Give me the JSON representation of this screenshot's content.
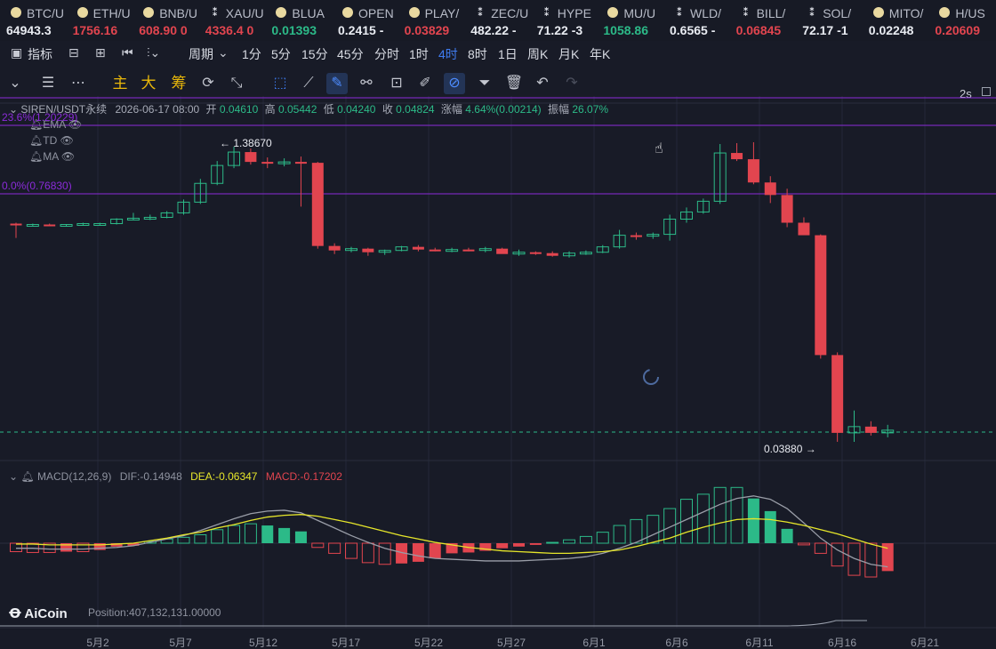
{
  "ticker": [
    {
      "symbol": "BTC/U",
      "price": "64943.3",
      "color": "#e9ecf2",
      "icon": "coin"
    },
    {
      "symbol": "ETH/U",
      "price": "1756.16",
      "color": "#e2454f",
      "icon": "coin"
    },
    {
      "symbol": "BNB/U",
      "price": "608.90",
      "suffix": "0",
      "color": "#e2454f",
      "icon": "coin"
    },
    {
      "symbol": "XAU/U",
      "price": "4336.4",
      "suffix": "0",
      "color": "#e2454f",
      "icon": "x"
    },
    {
      "symbol": "BLUA",
      "price": "0.01393",
      "color": "#2cba88",
      "icon": "coin"
    },
    {
      "symbol": "OPEN",
      "price": "0.2415",
      "suffix": "-",
      "color": "#e9ecf2",
      "icon": "coin"
    },
    {
      "symbol": "PLAY/",
      "price": "0.03829",
      "color": "#e2454f",
      "icon": "coin"
    },
    {
      "symbol": "ZEC/U",
      "price": "482.22",
      "suffix": "-",
      "color": "#e9ecf2",
      "icon": "x"
    },
    {
      "symbol": "HYPE",
      "price": "71.22",
      "suffix": "-3",
      "color": "#e9ecf2",
      "icon": "x"
    },
    {
      "symbol": "MU/U",
      "price": "1058.86",
      "color": "#2cba88",
      "icon": "coin"
    },
    {
      "symbol": "WLD/",
      "price": "0.6565",
      "suffix": "-",
      "color": "#e9ecf2",
      "icon": "x"
    },
    {
      "symbol": "BILL/",
      "price": "0.06845",
      "color": "#e2454f",
      "icon": "x"
    },
    {
      "symbol": "SOL/",
      "price": "72.17",
      "suffix": "-1",
      "color": "#e9ecf2",
      "icon": "x"
    },
    {
      "symbol": "MITO/",
      "price": "0.02248",
      "color": "#e9ecf2",
      "icon": "coin"
    },
    {
      "symbol": "H/US",
      "price": "0.20609",
      "color": "#e2454f",
      "icon": "coin"
    }
  ],
  "intervals": {
    "indicator_label": "指标",
    "period_label": "周期",
    "items": [
      "1分",
      "5分",
      "15分",
      "45分",
      "分时",
      "1时",
      "4时",
      "8时",
      "1日",
      "周K",
      "月K",
      "年K"
    ],
    "active": "4时",
    "refresh": "2s"
  },
  "drawing_tools": {
    "main_label": "主",
    "big_label": "大",
    "chip_label": "筹"
  },
  "chart_info": {
    "symbol": "SIREN/USDT永续",
    "time": "2026-06-17 08:00",
    "open_label": "开",
    "open": "0.04610",
    "high_label": "高",
    "high": "0.05442",
    "low_label": "低",
    "low": "0.04240",
    "close_label": "收",
    "close": "0.04824",
    "change_label": "涨幅",
    "change": "4.64%(0.00214)",
    "amp_label": "振幅",
    "amp": "26.07%",
    "indicators": [
      "EMA",
      "TD",
      "MA"
    ],
    "fib_top": "23.6%(1.20229)",
    "fib_mid": "0.0%(0.76830)",
    "high_marker": "1.38670",
    "low_marker": "0.03880"
  },
  "macd": {
    "title": "MACD(12,26,9)",
    "dif_label": "DIF:",
    "dif": "-0.14948",
    "dea_label": "DEA:",
    "dea": "-0.06347",
    "macd_label": "MACD:",
    "macd": "-0.17202"
  },
  "position_text": "Position:407,132,131.00000",
  "watermark": "AiCoin",
  "colors": {
    "up": "#2cba88",
    "down": "#e2454f",
    "dea": "#e6e62a",
    "dif": "#9a9ea8",
    "fib": "#8b2bd9",
    "accent": "#3f7cf0"
  },
  "chart_data": {
    "type": "candlestick",
    "interval": "4时",
    "x_ticks": [
      "5月2",
      "5月7",
      "5月12",
      "5月17",
      "5月22",
      "5月27",
      "6月1",
      "6月6",
      "6月11",
      "6月16",
      "6月21"
    ],
    "candles": [
      [
        0.52,
        0.53,
        0.36,
        0.51
      ],
      [
        0.51,
        0.52,
        0.49,
        0.51
      ],
      [
        0.51,
        0.52,
        0.5,
        0.5
      ],
      [
        0.5,
        0.51,
        0.49,
        0.51
      ],
      [
        0.51,
        0.53,
        0.5,
        0.52
      ],
      [
        0.52,
        0.53,
        0.5,
        0.52
      ],
      [
        0.52,
        0.58,
        0.51,
        0.57
      ],
      [
        0.57,
        0.64,
        0.56,
        0.58
      ],
      [
        0.58,
        0.62,
        0.56,
        0.59
      ],
      [
        0.59,
        0.66,
        0.58,
        0.64
      ],
      [
        0.64,
        0.79,
        0.62,
        0.76
      ],
      [
        0.76,
        1.02,
        0.74,
        0.97
      ],
      [
        0.97,
        1.22,
        0.95,
        1.17
      ],
      [
        1.17,
        1.38,
        1.14,
        1.32
      ],
      [
        1.32,
        1.36,
        1.18,
        1.21
      ],
      [
        1.21,
        1.26,
        1.14,
        1.19
      ],
      [
        1.19,
        1.25,
        1.16,
        1.21
      ],
      [
        1.21,
        1.27,
        0.71,
        1.2
      ],
      [
        1.2,
        1.21,
        0.24,
        0.27
      ],
      [
        0.27,
        0.3,
        0.18,
        0.22
      ],
      [
        0.22,
        0.26,
        0.2,
        0.24
      ],
      [
        0.24,
        0.25,
        0.16,
        0.2
      ],
      [
        0.2,
        0.23,
        0.17,
        0.22
      ],
      [
        0.22,
        0.27,
        0.21,
        0.26
      ],
      [
        0.26,
        0.28,
        0.21,
        0.23
      ],
      [
        0.23,
        0.25,
        0.21,
        0.22
      ],
      [
        0.22,
        0.25,
        0.2,
        0.23
      ],
      [
        0.23,
        0.25,
        0.21,
        0.22
      ],
      [
        0.22,
        0.26,
        0.2,
        0.24
      ],
      [
        0.24,
        0.25,
        0.19,
        0.18
      ],
      [
        0.18,
        0.23,
        0.16,
        0.2
      ],
      [
        0.2,
        0.21,
        0.17,
        0.19
      ],
      [
        0.19,
        0.21,
        0.15,
        0.16
      ],
      [
        0.16,
        0.21,
        0.14,
        0.19
      ],
      [
        0.19,
        0.22,
        0.17,
        0.2
      ],
      [
        0.2,
        0.28,
        0.19,
        0.26
      ],
      [
        0.26,
        0.45,
        0.24,
        0.39
      ],
      [
        0.39,
        0.42,
        0.34,
        0.38
      ],
      [
        0.38,
        0.42,
        0.35,
        0.4
      ],
      [
        0.4,
        0.62,
        0.33,
        0.57
      ],
      [
        0.57,
        0.7,
        0.53,
        0.65
      ],
      [
        0.65,
        0.8,
        0.63,
        0.77
      ],
      [
        0.77,
        1.41,
        0.74,
        1.31
      ],
      [
        1.31,
        1.42,
        1.22,
        1.24
      ],
      [
        1.24,
        1.43,
        0.96,
        0.98
      ],
      [
        0.98,
        1.05,
        0.75,
        0.84
      ],
      [
        0.84,
        0.91,
        0.48,
        0.53
      ],
      [
        0.53,
        0.59,
        0.43,
        0.39
      ],
      [
        0.39,
        0.4,
        -0.99,
        -0.95
      ],
      [
        -0.95,
        -0.92,
        -1.92,
        -1.82
      ],
      [
        -1.82,
        -1.57,
        -1.92,
        -1.75
      ],
      [
        -1.75,
        -1.69,
        -1.85,
        -1.82
      ],
      [
        -1.82,
        -1.73,
        -1.87,
        -1.79
      ]
    ],
    "macd_hist": [
      -0.1,
      -0.11,
      -0.11,
      -0.1,
      -0.1,
      -0.08,
      -0.04,
      -0.03,
      0.02,
      0.05,
      0.07,
      0.1,
      0.16,
      0.21,
      0.23,
      0.21,
      0.18,
      0.14,
      -0.05,
      -0.12,
      -0.18,
      -0.23,
      -0.25,
      -0.24,
      -0.22,
      -0.18,
      -0.12,
      -0.11,
      -0.09,
      -0.06,
      -0.04,
      -0.02,
      0.01,
      0.04,
      0.08,
      0.13,
      0.21,
      0.28,
      0.33,
      0.41,
      0.52,
      0.58,
      0.66,
      0.66,
      0.53,
      0.38,
      0.17,
      -0.02,
      -0.12,
      -0.27,
      -0.38,
      -0.4,
      -0.33
    ],
    "dif": [
      -0.06,
      -0.06,
      -0.07,
      -0.07,
      -0.07,
      -0.06,
      -0.05,
      -0.03,
      0.01,
      0.05,
      0.09,
      0.15,
      0.22,
      0.29,
      0.35,
      0.38,
      0.39,
      0.36,
      0.27,
      0.18,
      0.09,
      0.01,
      -0.06,
      -0.11,
      -0.15,
      -0.18,
      -0.19,
      -0.2,
      -0.21,
      -0.21,
      -0.21,
      -0.2,
      -0.19,
      -0.18,
      -0.16,
      -0.12,
      -0.06,
      0.01,
      0.1,
      0.19,
      0.28,
      0.37,
      0.46,
      0.53,
      0.56,
      0.52,
      0.41,
      0.24,
      0.06,
      -0.08,
      -0.18,
      -0.25,
      -0.28
    ],
    "dea": [
      -0.01,
      -0.01,
      -0.02,
      -0.02,
      -0.02,
      -0.02,
      -0.01,
      0.0,
      0.03,
      0.06,
      0.1,
      0.13,
      0.18,
      0.22,
      0.27,
      0.31,
      0.33,
      0.34,
      0.32,
      0.28,
      0.24,
      0.19,
      0.14,
      0.09,
      0.05,
      0.01,
      -0.02,
      -0.05,
      -0.07,
      -0.09,
      -0.1,
      -0.11,
      -0.12,
      -0.12,
      -0.11,
      -0.1,
      -0.08,
      -0.04,
      0.01,
      0.06,
      0.13,
      0.19,
      0.24,
      0.28,
      0.29,
      0.28,
      0.25,
      0.21,
      0.16,
      0.11,
      0.05,
      -0.01,
      -0.06
    ]
  }
}
